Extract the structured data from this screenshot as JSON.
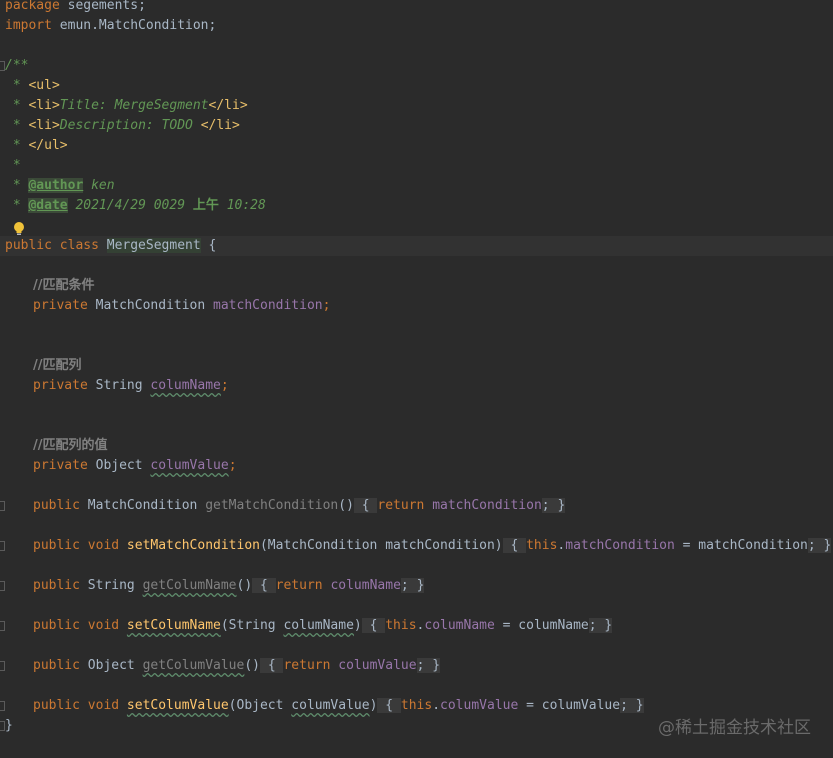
{
  "code": {
    "l1": {
      "kw": "package",
      "rest": " segements;"
    },
    "l2": {
      "kw": "import",
      "rest": " emun.MatchCondition;"
    },
    "l4": {
      "text": "/**"
    },
    "l5": {
      "star": " * ",
      "tag": "<ul>"
    },
    "l6": {
      "star": " * ",
      "tag_open": "<li>",
      "text": "Title: MergeSegment",
      "tag_close": "</li>"
    },
    "l7": {
      "star": " * ",
      "tag_open": "<li>",
      "text": "Description: TODO ",
      "tag_close": "</li>"
    },
    "l8": {
      "star": " * ",
      "tag": "</ul>"
    },
    "l9": {
      "text": " *"
    },
    "l10": {
      "star": " * ",
      "doctag": "@author",
      "text": " ken"
    },
    "l11": {
      "star": " * ",
      "doctag": "@date",
      "text": " 2021/4/29 0029 ",
      "bold": "上午",
      "time": " 10:28"
    },
    "l12": {
      "text": " */"
    },
    "l13": {
      "kw": "public class ",
      "name": "MergeSegment",
      "rest": " {"
    },
    "l15": {
      "comment": "//匹配条件"
    },
    "l16": {
      "kw": "private ",
      "type": "MatchCondition ",
      "field": "matchCondition",
      "semi": ";"
    },
    "l19": {
      "comment": "//匹配列"
    },
    "l20": {
      "kw": "private ",
      "type": "String ",
      "field": "columName",
      "semi": ";"
    },
    "l23": {
      "comment": "//匹配列的值"
    },
    "l24": {
      "kw": "private ",
      "type": "Object ",
      "field": "columValue",
      "semi": ";"
    },
    "l26": {
      "kw": "public ",
      "type": "MatchCondition ",
      "method": "getMatchCondition",
      "paren": "()",
      "ob": " { ",
      "ret": "return ",
      "field": "matchCondition",
      "semi": "; ",
      "cb": "}"
    },
    "l28": {
      "kw": "public void ",
      "method": "setMatchCondition",
      "args": "(MatchCondition matchCondition)",
      "ob": " { ",
      "this": "this",
      "dot": ".",
      "field": "matchCondition",
      "assign": " = matchCondition",
      "semi": "; ",
      "cb": "}"
    },
    "l30": {
      "kw": "public ",
      "type": "String ",
      "method": "getColumName",
      "paren": "()",
      "ob": " { ",
      "ret": "return ",
      "field": "columName",
      "semi": "; ",
      "cb": "}"
    },
    "l32": {
      "kw": "public void ",
      "method": "setColumName",
      "args_a": "(String ",
      "args_b": "columName",
      "args_c": ")",
      "ob": " { ",
      "this": "this",
      "dot": ".",
      "field": "columName",
      "assign": " = columName",
      "semi": "; ",
      "cb": "}"
    },
    "l34": {
      "kw": "public ",
      "type": "Object ",
      "method": "getColumValue",
      "paren": "()",
      "ob": " { ",
      "ret": "return ",
      "field": "columValue",
      "semi": "; ",
      "cb": "}"
    },
    "l36": {
      "kw": "public void ",
      "method": "setColumValue",
      "args_a": "(Object ",
      "args_b": "columValue",
      "args_c": ")",
      "ob": " { ",
      "this": "this",
      "dot": ".",
      "field": "columValue",
      "assign": " = columValue",
      "semi": "; ",
      "cb": "}"
    },
    "l37": {
      "text": "}"
    }
  },
  "watermark": "@稀土掘金技术社区",
  "colors": {
    "background": "#2b2b2b",
    "keyword": "#cc7832",
    "field": "#9876aa",
    "method": "#ffc66d",
    "doc": "#629755"
  },
  "icons": {
    "bulb": "lightbulb-icon",
    "fold": "fold-marker-icon"
  }
}
